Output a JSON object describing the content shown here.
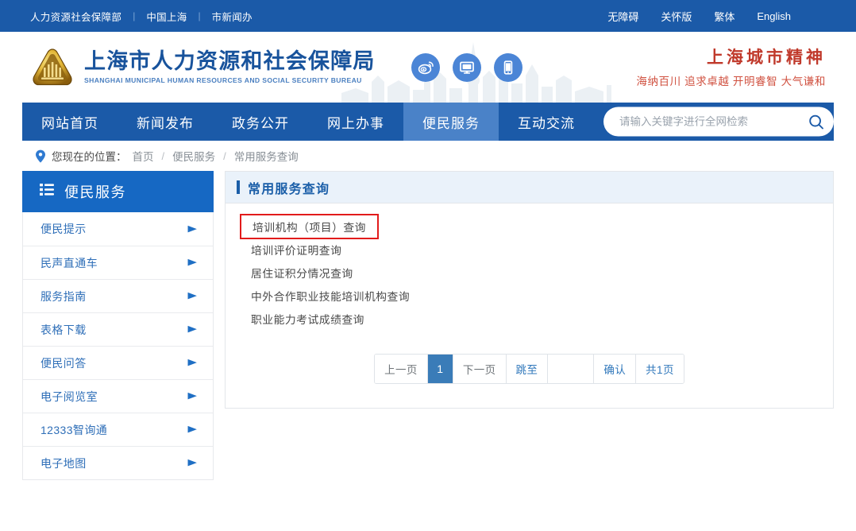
{
  "colors": {
    "nav_blue": "#1b5aa8",
    "nav_active_blue": "#4a82c8",
    "sidebar_head_blue": "#1668c3",
    "link_blue": "#2f6fb8",
    "brand_blue": "#18539c",
    "slogan_red": "#c0392b",
    "highlight_red": "#e21b1b",
    "panel_head_bg": "#eaf2fa",
    "pager_active": "#3a7cb8"
  },
  "topbar": {
    "left_links": [
      {
        "label": "人力资源社会保障部"
      },
      {
        "label": "中国上海"
      },
      {
        "label": "市新闻办"
      }
    ],
    "separator": "|",
    "right_links": [
      {
        "label": "无障碍",
        "name": "accessibility"
      },
      {
        "label": "关怀版",
        "name": "elder-care-version"
      },
      {
        "label": "繁体",
        "name": "traditional-chinese"
      },
      {
        "label": "English",
        "name": "english"
      }
    ]
  },
  "banner": {
    "logo_icon": "government-emblem-icon",
    "brand_cn": "上海市人力资源和社会保障局",
    "brand_en": "SHANGHAI MUNICIPAL HUMAN RESOURCES AND SOCIAL SECURITY BUREAU",
    "socials": [
      {
        "name": "weibo-icon",
        "label": "微博"
      },
      {
        "name": "desktop-icon",
        "label": "电脑版"
      },
      {
        "name": "mobile-icon",
        "label": "手机版"
      }
    ],
    "slogan_title": "上海城市精神",
    "slogan_sub": "海纳百川 追求卓越 开明睿智 大气谦和"
  },
  "nav": {
    "items": [
      {
        "label": "网站首页",
        "name": "home",
        "active": false
      },
      {
        "label": "新闻发布",
        "name": "news",
        "active": false
      },
      {
        "label": "政务公开",
        "name": "government-affairs",
        "active": false
      },
      {
        "label": "网上办事",
        "name": "online-services",
        "active": false
      },
      {
        "label": "便民服务",
        "name": "convenience-services",
        "active": true
      },
      {
        "label": "互动交流",
        "name": "interaction",
        "active": false
      }
    ],
    "search": {
      "placeholder": "请输入关键字进行全网检索",
      "value": "",
      "button_icon": "search-icon"
    }
  },
  "breadcrumb": {
    "pin_icon": "location-pin-icon",
    "label": "您现在的位置：",
    "items": [
      {
        "label": "首页"
      },
      {
        "label": "便民服务"
      },
      {
        "label": "常用服务查询"
      }
    ],
    "separator": "/"
  },
  "sidebar": {
    "icon": "list-menu-icon",
    "title": "便民服务",
    "arrow_icon": "triangle-right-icon",
    "items": [
      {
        "label": "便民提示"
      },
      {
        "label": "民声直通车"
      },
      {
        "label": "服务指南"
      },
      {
        "label": "表格下载"
      },
      {
        "label": "便民问答"
      },
      {
        "label": "电子阅览室"
      },
      {
        "label": "12333智询通"
      },
      {
        "label": "电子地图"
      }
    ]
  },
  "content": {
    "title": "常用服务查询",
    "items": [
      {
        "label": "培训机构（项目）查询",
        "highlighted": true
      },
      {
        "label": "培训评价证明查询",
        "highlighted": false
      },
      {
        "label": "居住证积分情况查询",
        "highlighted": false
      },
      {
        "label": "中外合作职业技能培训机构查询",
        "highlighted": false
      },
      {
        "label": "职业能力考试成绩查询",
        "highlighted": false
      }
    ],
    "pagination": {
      "prev_label": "上一页",
      "current_page": "1",
      "next_label": "下一页",
      "jump_label": "跳至",
      "jump_value": "",
      "confirm_label": "确认",
      "total_label": "共1页"
    }
  }
}
